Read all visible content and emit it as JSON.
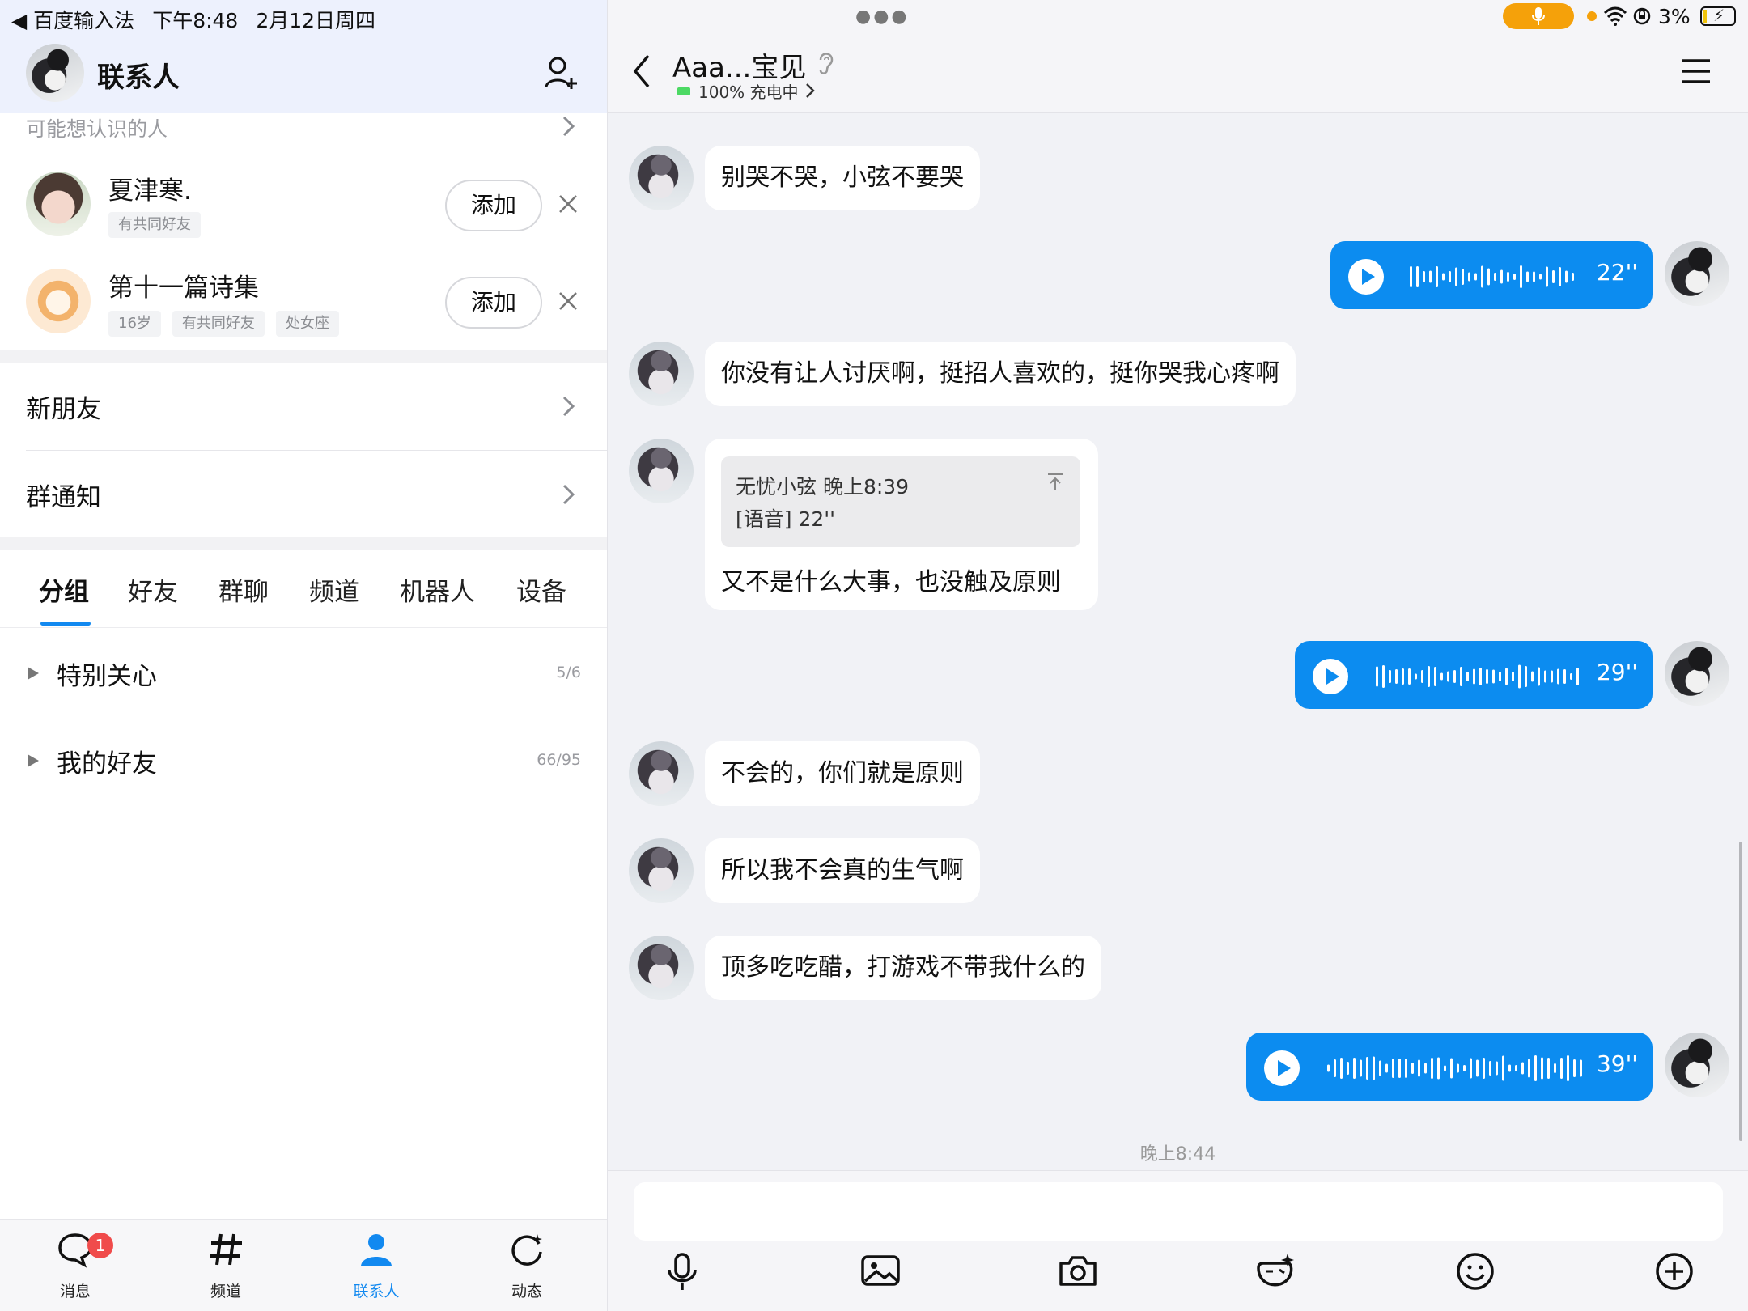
{
  "status": {
    "back_app": "◀ 百度输入法",
    "time": "下午8:48",
    "date": "2月12日周四",
    "battery_percent": "3%",
    "accent_mic": "#f5a10a"
  },
  "left": {
    "title": "联系人",
    "suggest_header": "可能想认识的人",
    "suggestions": [
      {
        "name": "夏津寒.",
        "tags": [
          "有共同好友"
        ],
        "add_label": "添加"
      },
      {
        "name": "第十一篇诗集",
        "tags": [
          "16岁",
          "有共同好友",
          "处女座"
        ],
        "add_label": "添加"
      }
    ],
    "menu": [
      {
        "label": "新朋友"
      },
      {
        "label": "群通知"
      }
    ],
    "tabs": [
      "分组",
      "好友",
      "群聊",
      "频道",
      "机器人",
      "设备"
    ],
    "active_tab": "分组",
    "groups": [
      {
        "name": "特别关心",
        "count": "5/6"
      },
      {
        "name": "我的好友",
        "count": "66/95"
      }
    ],
    "nav": [
      {
        "label": "消息",
        "badge": "1"
      },
      {
        "label": "频道"
      },
      {
        "label": "联系人"
      },
      {
        "label": "动态"
      }
    ],
    "accent": "#1289f0"
  },
  "chat": {
    "title": "Aaa...宝见",
    "subtitle": "100% 充电中",
    "messages": [
      {
        "side": "in",
        "type": "text",
        "text": "别哭不哭，小弦不要哭"
      },
      {
        "side": "out",
        "type": "voice",
        "duration": "22''"
      },
      {
        "side": "in",
        "type": "text",
        "text": "你没有让人讨厌啊，挺招人喜欢的，挺你哭我心疼啊"
      },
      {
        "side": "in",
        "type": "reply",
        "quote_sender": "无忧小弦 晚上8:39",
        "quote_text": "[语音] 22''",
        "text": "又不是什么大事，也没触及原则"
      },
      {
        "side": "out",
        "type": "voice",
        "duration": "29''"
      },
      {
        "side": "in",
        "type": "text",
        "text": "不会的，你们就是原则"
      },
      {
        "side": "in",
        "type": "text",
        "text": "所以我不会真的生气啊"
      },
      {
        "side": "in",
        "type": "text",
        "text": "顶多吃吃醋，打游戏不带我什么的"
      },
      {
        "side": "out",
        "type": "voice",
        "duration": "39''"
      }
    ],
    "timestamp": "晚上8:44",
    "input_placeholder": "",
    "voice_color": "#0c8cf0"
  }
}
